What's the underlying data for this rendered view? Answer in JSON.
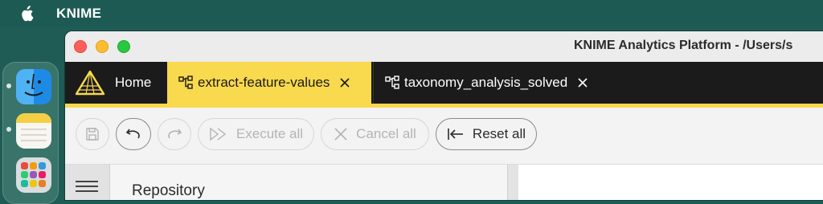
{
  "menubar": {
    "app_name": "KNIME"
  },
  "window": {
    "title": "KNIME Analytics Platform - /Users/s"
  },
  "tabs": [
    {
      "label": "Home",
      "icon": "knime-logo-icon"
    },
    {
      "label": "extract-feature-values",
      "icon": "workflow-icon",
      "active": true
    },
    {
      "label": "taxonomy_analysis_solved",
      "icon": "workflow-icon"
    }
  ],
  "toolbar": {
    "save_icon": "save-icon",
    "undo_icon": "undo-icon",
    "redo_icon": "redo-icon",
    "execute_all": "Execute all",
    "cancel_all": "Cancel all",
    "reset_all": "Reset all"
  },
  "panels": {
    "repository_title": "Repository"
  },
  "colors": {
    "accent": "#f9d94d",
    "tabbar": "#1b1b1b",
    "desktop": "#1f5c55"
  }
}
